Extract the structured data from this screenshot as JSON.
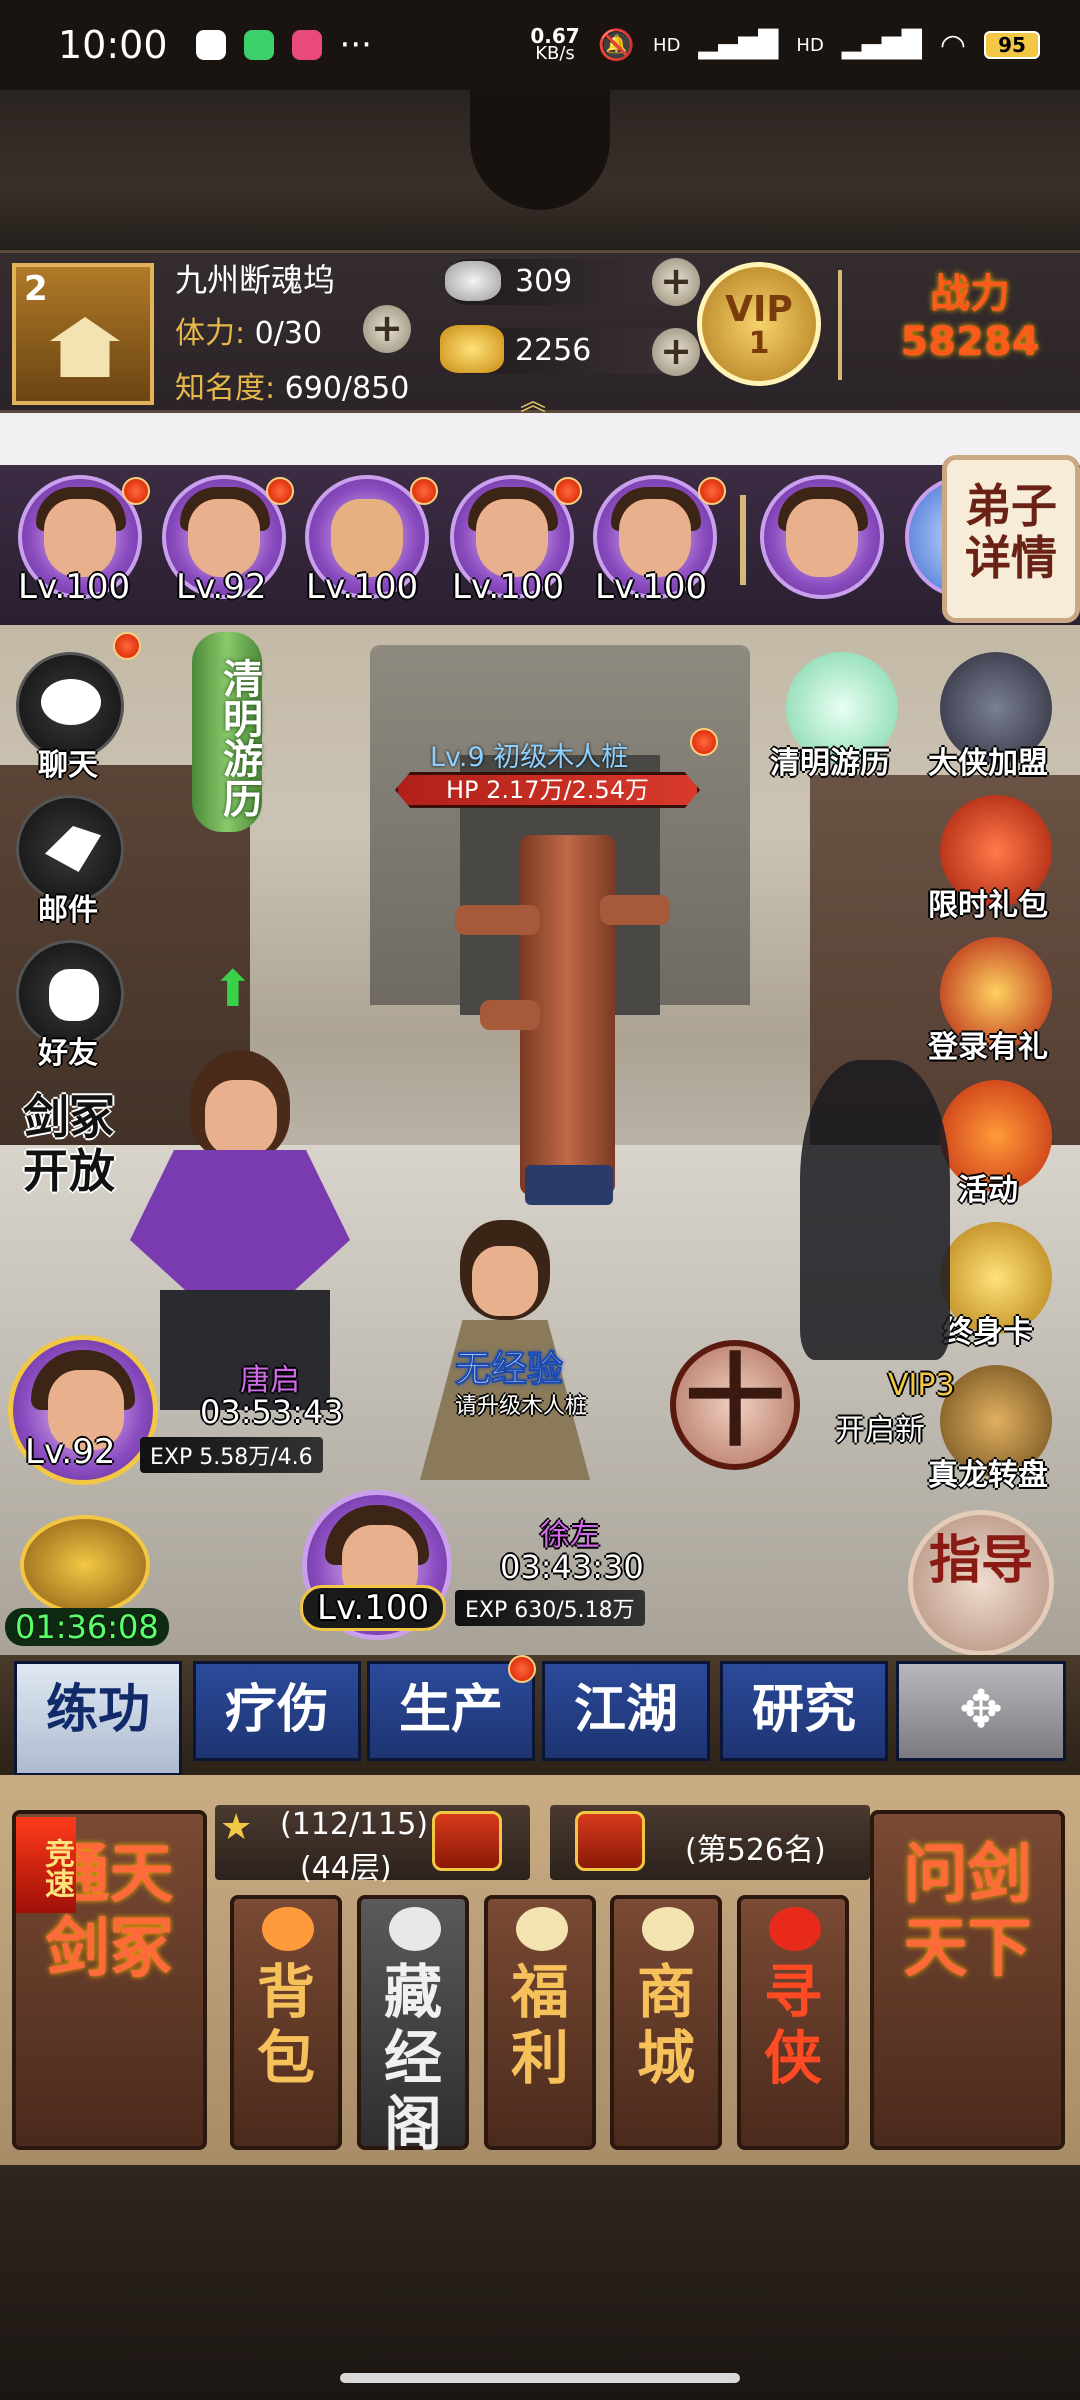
{
  "status_bar": {
    "time": "10:00",
    "net_speed": "0.67",
    "net_unit": "KB/s",
    "sig1": "HD",
    "sig2": "HD",
    "battery": "95"
  },
  "header": {
    "rank": "2",
    "player_name": "九州断魂坞",
    "stamina_label": "体力:",
    "stamina_value": "0/30",
    "fame_label": "知名度:",
    "fame_value": "690/850",
    "silver": "309",
    "gold": "2256",
    "vip_text": "VIP",
    "vip_level": "1",
    "power_label": "战力",
    "power_value": "58284"
  },
  "disciples": {
    "levels": [
      "Lv.100",
      "Lv.92",
      "Lv.100",
      "Lv.100",
      "Lv.100"
    ],
    "detail_button": "弟子详情"
  },
  "left_menu": {
    "chat": "聊天",
    "mail": "邮件",
    "friends": "好友",
    "sword_open": "剑冢开放",
    "banner": "清明游历"
  },
  "right_menu": {
    "items": [
      "清明游历",
      "大侠加盟",
      "限时礼包",
      "登录有礼",
      "活动",
      "终身卡",
      "真龙转盘"
    ],
    "vip3": "VIP3",
    "unlock": "开启新"
  },
  "target": {
    "name": "Lv.9 初级木人桩",
    "hp": "HP 2.17万/2.54万"
  },
  "character1": {
    "name": "唐启",
    "time": "03:53:43",
    "level": "Lv.92",
    "exp": "EXP 5.58万/4.6"
  },
  "character2": {
    "name": "徐左",
    "time": "03:43:30",
    "level": "Lv.100",
    "exp": "EXP 630/5.18万",
    "status": "无经验",
    "hint": "请升级木人桩"
  },
  "shop_timer": "01:36:08",
  "guide_button": "指导",
  "tabs": [
    "练功",
    "疗伤",
    "生产",
    "江湖",
    "研究"
  ],
  "bottom_panel": {
    "left_button": "通天剑冢",
    "left_badge": "竞速",
    "progress_top": "(112/115)",
    "progress_floor": "(44层)",
    "ranking": "(第526名)",
    "right_button": "问剑天下",
    "small_buttons": [
      "背包",
      "藏经阁",
      "福利",
      "商城",
      "寻侠"
    ]
  }
}
